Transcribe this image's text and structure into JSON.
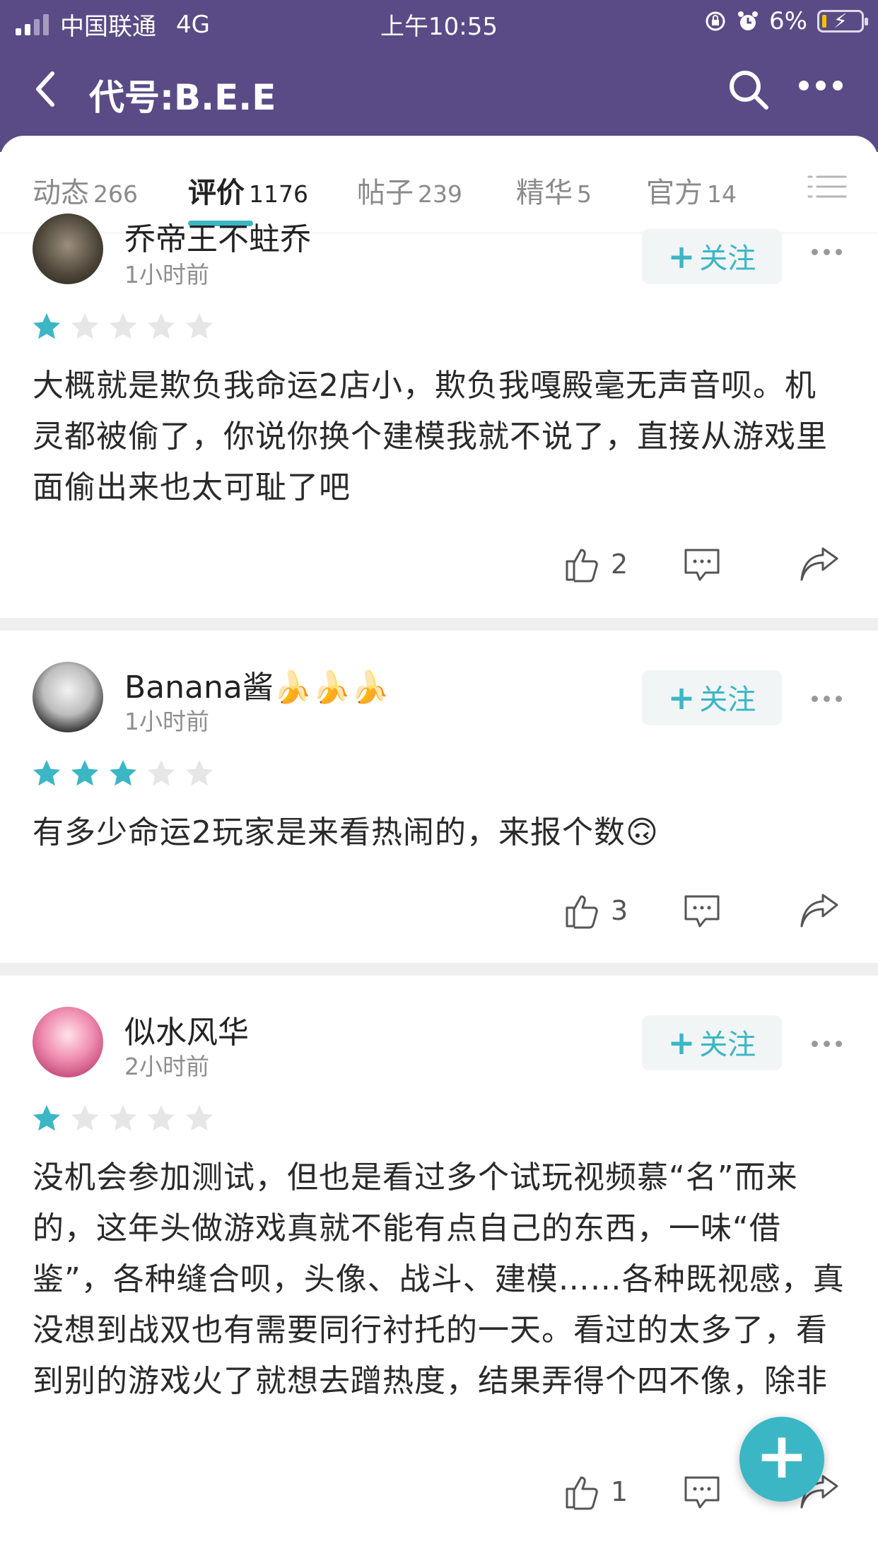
{
  "status_bar": {
    "carrier": "中国联通",
    "network": "4G",
    "time": "上午10:55",
    "battery": "6%"
  },
  "header": {
    "title": "代号:B.E.E"
  },
  "tabs": [
    {
      "label": "动态",
      "count": "266"
    },
    {
      "label": "评价",
      "count": "1176"
    },
    {
      "label": "帖子",
      "count": "239"
    },
    {
      "label": "精华",
      "count": "5"
    },
    {
      "label": "官方",
      "count": "14"
    }
  ],
  "accent_color": "#3bb6c4",
  "header_color": "#5a4b86",
  "follow_label": "关注",
  "reviews": [
    {
      "user": "乔帝王不蛀乔",
      "time": "1小时前",
      "rating": 1,
      "text": "大概就是欺负我命运2店小，欺负我嘎殿毫无声音呗。机灵都被偷了，你说你换个建模我就不说了，直接从游戏里面偷出来也太可耻了吧",
      "likes": "2"
    },
    {
      "user": "Banana酱🍌🍌🍌",
      "time": "1小时前",
      "rating": 3,
      "text": "有多少命运2玩家是来看热闹的，来报个数🙃",
      "likes": "3"
    },
    {
      "user": "似水风华",
      "time": "2小时前",
      "rating": 1,
      "text": "没机会参加测试，但也是看过多个试玩视频慕“名”而来的，这年头做游戏真就不能有点自己的东西，一味“借鉴”，各种缝合呗，头像、战斗、建模……各种既视感，真没想到战双也有需要同行衬托的一天。看过的太多了，看到别的游戏火了就想去蹭热度，结果弄得个四不像，除非打着公测骗氪一波卷钱就走的",
      "likes": "1"
    }
  ]
}
